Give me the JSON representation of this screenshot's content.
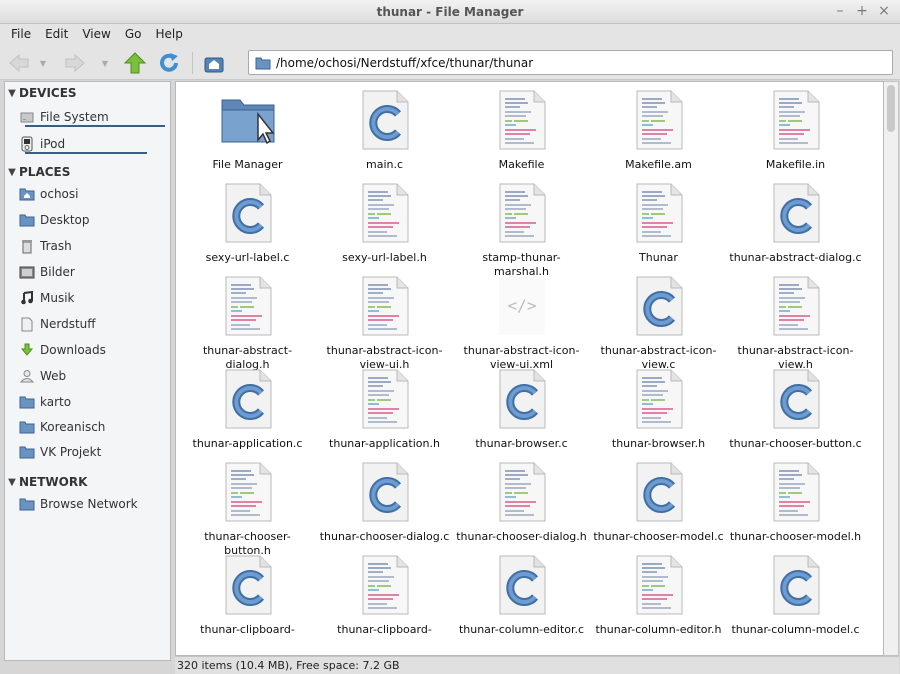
{
  "window": {
    "title": "thunar - File Manager",
    "controls": [
      "–",
      "+",
      "×"
    ]
  },
  "menu": [
    "File",
    "Edit",
    "View",
    "Go",
    "Help"
  ],
  "toolbar": {
    "path": "/home/ochosi/Nerdstuff/xfce/thunar/thunar"
  },
  "sidebar": {
    "devices_heading": "DEVICES",
    "devices": [
      {
        "label": "File System",
        "icon": "drive-icon"
      },
      {
        "label": "iPod",
        "icon": "ipod-icon"
      }
    ],
    "places_heading": "PLACES",
    "places": [
      {
        "label": "ochosi",
        "icon": "home-folder-icon"
      },
      {
        "label": "Desktop",
        "icon": "desktop-icon"
      },
      {
        "label": "Trash",
        "icon": "trash-icon"
      },
      {
        "label": "Bilder",
        "icon": "pictures-icon"
      },
      {
        "label": "Musik",
        "icon": "music-icon"
      },
      {
        "label": "Nerdstuff",
        "icon": "folder-icon"
      },
      {
        "label": "Downloads",
        "icon": "downloads-icon"
      },
      {
        "label": "Web",
        "icon": "user-icon"
      },
      {
        "label": "karto",
        "icon": "folder-icon"
      },
      {
        "label": "Koreanisch",
        "icon": "folder-icon"
      },
      {
        "label": "VK Projekt",
        "icon": "folder-icon"
      }
    ],
    "network_heading": "NETWORK",
    "network": [
      {
        "label": "Browse Network",
        "icon": "network-icon"
      }
    ]
  },
  "files": [
    {
      "name": "File Manager",
      "type": "folder"
    },
    {
      "name": "main.c",
      "type": "c"
    },
    {
      "name": "Makefile",
      "type": "text"
    },
    {
      "name": "Makefile.am",
      "type": "text"
    },
    {
      "name": "Makefile.in",
      "type": "text"
    },
    {
      "name": "sexy-url-label.c",
      "type": "c"
    },
    {
      "name": "sexy-url-label.h",
      "type": "text"
    },
    {
      "name": "stamp-thunar-marshal.h",
      "type": "text"
    },
    {
      "name": "Thunar",
      "type": "text"
    },
    {
      "name": "thunar-abstract-dialog.c",
      "type": "c"
    },
    {
      "name": "thunar-abstract-dialog.h",
      "type": "text"
    },
    {
      "name": "thunar-abstract-icon-view-ui.h",
      "type": "text"
    },
    {
      "name": "thunar-abstract-icon-view-ui.xml",
      "type": "xml"
    },
    {
      "name": "thunar-abstract-icon-view.c",
      "type": "c"
    },
    {
      "name": "thunar-abstract-icon-view.h",
      "type": "text"
    },
    {
      "name": "thunar-application.c",
      "type": "c"
    },
    {
      "name": "thunar-application.h",
      "type": "text"
    },
    {
      "name": "thunar-browser.c",
      "type": "c"
    },
    {
      "name": "thunar-browser.h",
      "type": "text"
    },
    {
      "name": "thunar-chooser-button.c",
      "type": "c"
    },
    {
      "name": "thunar-chooser-button.h",
      "type": "text"
    },
    {
      "name": "thunar-chooser-dialog.c",
      "type": "c"
    },
    {
      "name": "thunar-chooser-dialog.h",
      "type": "text"
    },
    {
      "name": "thunar-chooser-model.c",
      "type": "c"
    },
    {
      "name": "thunar-chooser-model.h",
      "type": "text"
    },
    {
      "name": "thunar-clipboard-",
      "type": "c"
    },
    {
      "name": "thunar-clipboard-",
      "type": "text"
    },
    {
      "name": "thunar-column-editor.c",
      "type": "c"
    },
    {
      "name": "thunar-column-editor.h",
      "type": "text"
    },
    {
      "name": "thunar-column-model.c",
      "type": "c"
    }
  ],
  "status": "320 items (10.4 MB), Free space: 7.2 GB"
}
